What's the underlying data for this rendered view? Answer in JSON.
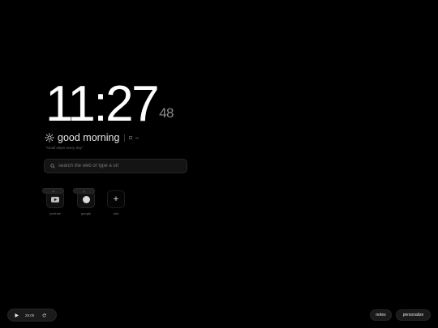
{
  "clock": {
    "time": "11:27",
    "seconds": "48"
  },
  "greeting": {
    "text": "good morning",
    "icon": "sun-icon"
  },
  "tagline": "small steps every day",
  "search": {
    "placeholder": "search the web or type a url",
    "icon": "search-icon"
  },
  "shortcuts": [
    {
      "label": "youtube",
      "tooltip": "yt",
      "icon": "youtube-icon"
    },
    {
      "label": "google",
      "tooltip": "g",
      "icon": "google-icon"
    },
    {
      "label": "add",
      "icon": "plus-icon"
    }
  ],
  "timer": {
    "time": "25:00",
    "play_icon": "play-icon",
    "reset_icon": "reset-icon"
  },
  "buttons": {
    "notes": "notes",
    "personalize": "personalize"
  },
  "colors": {
    "background": "#000000",
    "text": "#ffffff",
    "muted": "#8a8a8a",
    "surface": "#1a1a1a"
  }
}
